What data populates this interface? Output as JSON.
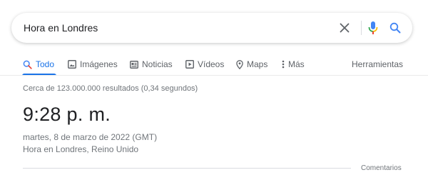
{
  "search": {
    "query": "Hora en Londres"
  },
  "tabs": [
    {
      "label": "Todo",
      "icon": "search-icon",
      "active": true
    },
    {
      "label": "Imágenes",
      "icon": "image-icon"
    },
    {
      "label": "Noticias",
      "icon": "news-icon"
    },
    {
      "label": "Vídeos",
      "icon": "video-icon"
    },
    {
      "label": "Maps",
      "icon": "map-pin-icon"
    },
    {
      "label": "Más",
      "icon": "more-vert-icon"
    }
  ],
  "tools_label": "Herramientas",
  "result_stats": "Cerca de 123.000.000 resultados (0,34 segundos)",
  "time_card": {
    "time": "9:28 p. m.",
    "date": "martes, 8 de marzo de 2022 (GMT)",
    "place": "Hora en Londres, Reino Unido"
  },
  "feedback_label": "Comentarios",
  "colors": {
    "accent": "#1a73e8",
    "text": "#202124",
    "muted": "#5f6368",
    "secondary": "#70757a"
  }
}
